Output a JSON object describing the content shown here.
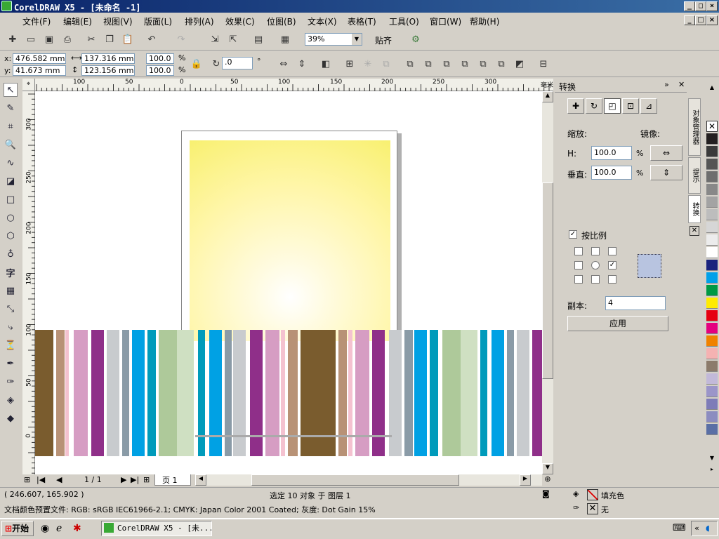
{
  "titlebar": {
    "title": "CorelDRAW X5 - [未命名 -1]",
    "colors": {
      "start": "#0a246a",
      "end": "#3a6ea5"
    }
  },
  "menubar": {
    "items": [
      "文件(F)",
      "编辑(E)",
      "视图(V)",
      "版面(L)",
      "排列(A)",
      "效果(C)",
      "位图(B)",
      "文本(X)",
      "表格(T)",
      "工具(O)",
      "窗口(W)",
      "帮助(H)"
    ]
  },
  "toolbar": {
    "zoom": "39%",
    "snap_label": "贴齐"
  },
  "propbar": {
    "x_label": "x:",
    "x_value": "476.582 mm",
    "y_label": "y:",
    "y_value": "41.673 mm",
    "width_value": "137.316 mm",
    "height_value": "123.156 mm",
    "scale_x": "100.0",
    "scale_y": "100.0",
    "percent": "%",
    "rotation": ".0",
    "degree": "°"
  },
  "hruler": {
    "ticks": [
      "100",
      "50",
      "0",
      "50",
      "100",
      "150",
      "200",
      "250",
      "300"
    ],
    "unit": "毫米"
  },
  "vruler": {
    "ticks": [
      "300",
      "250",
      "200",
      "150",
      "100",
      "50",
      "0"
    ]
  },
  "pagenav": {
    "counter": "1 / 1",
    "page_tab": "页 1"
  },
  "docker": {
    "title": "转换",
    "scale_label": "缩放:",
    "mirror_label": "镜像:",
    "h_label": "H:",
    "h_value": "100.0",
    "v_label": "垂直:",
    "v_value": "100.0",
    "percent": "%",
    "proportional_label": "按比例",
    "copies_label": "副本:",
    "copies_value": "4",
    "apply_label": "应用"
  },
  "dockertabs": [
    "对象管理器",
    "提示",
    "转换"
  ],
  "palette": [
    "#231f20",
    "#3a3a3a",
    "#555555",
    "#6e6e6e",
    "#888888",
    "#a3a3a3",
    "#bdbdbd",
    "#d6d6d6",
    "#ececec",
    "#ffffff",
    "#1a237e",
    "#00a0e9",
    "#009944",
    "#ffeb00",
    "#e60012",
    "#e4007f",
    "#f08200",
    "#f5b2b2",
    "#8c7b6b",
    "#c2b9d9",
    "#9b95c9",
    "#7e7cb8",
    "#8c8cc0",
    "#5a6fa5"
  ],
  "status": {
    "coords": "( 246.607, 165.902 )",
    "selection": "选定 10 对象 于 图层 1",
    "fill_label": "填充色",
    "outline_label": "无",
    "color_profile": "文档颜色预置文件: RGB: sRGB IEC61966-2.1; CMYK: Japan Color 2001 Coated; 灰度: Dot Gain 15%"
  },
  "taskbar": {
    "start_label": "开始",
    "task_label": "CorelDRAW X5 - [未..."
  },
  "stripes": {
    "colors": [
      "#7a5c2e",
      "#b89276",
      "#f4c2d0",
      "#d69dc3",
      "#8f2f89",
      "#c8cbce",
      "#8a9ba7",
      "#00a1e4",
      "#009bbb",
      "#aec99a",
      "#cfe0c2"
    ]
  }
}
